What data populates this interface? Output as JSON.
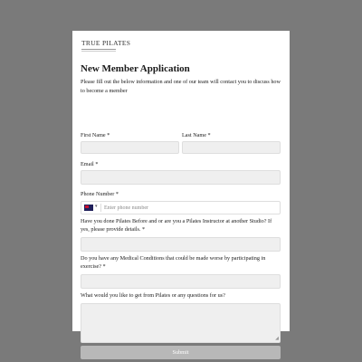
{
  "brand": {
    "logo_text": "TRUE PILATES"
  },
  "form": {
    "title": "New Member Application",
    "intro": "Please fill out the below information and one of our team will contact you to discuss how to become a member",
    "fields": {
      "first_name_label": "First Name *",
      "last_name_label": "Last Name *",
      "email_label": "Email *",
      "phone_label": "Phone Number *",
      "phone_placeholder": "Enter phone number",
      "pilates_label": "Have you done Pilates Before and or are you a Pilates Instructor at another Studio? If yes, please provide details. *",
      "medical_label": "Do you have any Medical Conditions that could be made worse by participating in exercise? *",
      "questions_label": "What would you like to get from Pilates or any questions for us?"
    },
    "submit_label": "Submit"
  },
  "icons": {
    "flag": "australia-flag-icon",
    "caret": "chevron-down-icon"
  },
  "colors": {
    "page_bg": "#7a7a7a",
    "card_bg": "#ffffff",
    "input_bg": "#efefef",
    "button_bg": "#b8b8b8"
  }
}
